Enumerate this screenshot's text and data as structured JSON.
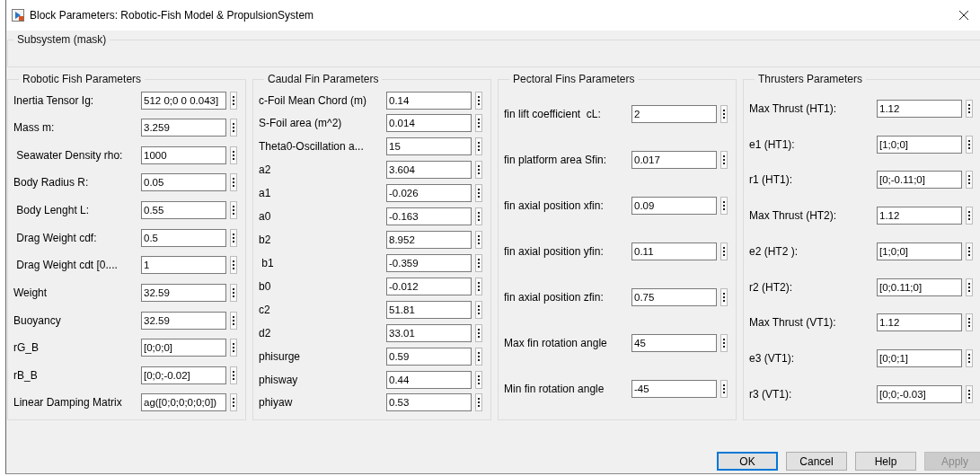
{
  "window": {
    "title": "Block Parameters: Robotic-Fish Model & PropulsionSystem"
  },
  "mask": {
    "title": "Subsystem (mask)"
  },
  "groups": [
    {
      "title": "Robotic Fish Parameters",
      "params": [
        {
          "label": "Inertia Tensor Ig:",
          "value": "512 0;0 0 0.043]"
        },
        {
          "label": "Mass m:",
          "value": "3.259"
        },
        {
          "label": " Seawater Density rho:",
          "value": "1000"
        },
        {
          "label": "Body Radius R:",
          "value": "0.05"
        },
        {
          "label": " Body Lenght L:",
          "value": "0.55"
        },
        {
          "label": " Drag Weight cdf:",
          "value": "0.5"
        },
        {
          "label": " Drag Weight cdt [0....",
          "value": "1"
        },
        {
          "label": "Weight",
          "value": "32.59"
        },
        {
          "label": "Buoyancy",
          "value": "32.59"
        },
        {
          "label": "rG_B",
          "value": "[0;0;0]"
        },
        {
          "label": "rB_B",
          "value": "[0;0;-0.02]"
        },
        {
          "label": "Linear Damping Matrix",
          "value": "ag([0;0;0;0;0;0])"
        }
      ]
    },
    {
      "title": "Caudal Fin Parameters",
      "params": [
        {
          "label": "c-Foil Mean Chord (m)",
          "value": "0.14"
        },
        {
          "label": "S-Foil area (m^2)",
          "value": "0.014"
        },
        {
          "label": "Theta0-Oscillation a...",
          "value": "15"
        },
        {
          "label": "a2",
          "value": "3.604"
        },
        {
          "label": "a1",
          "value": "-0.026"
        },
        {
          "label": "a0",
          "value": "-0.163"
        },
        {
          "label": "b2",
          "value": "8.952"
        },
        {
          "label": " b1",
          "value": "-0.359"
        },
        {
          "label": "b0",
          "value": "-0.012"
        },
        {
          "label": "c2",
          "value": "51.81"
        },
        {
          "label": "d2",
          "value": "33.01"
        },
        {
          "label": "phisurge",
          "value": "0.59"
        },
        {
          "label": "phisway",
          "value": "0.44"
        },
        {
          "label": "phiyaw",
          "value": "0.53"
        }
      ]
    },
    {
      "title": "Pectoral Fins Parameters",
      "params": [
        {
          "label": "fin lift coefficient  cL:",
          "value": "2"
        },
        {
          "label": "fin platform area Sfin:",
          "value": "0.017"
        },
        {
          "label": "fin axial position xfin:",
          "value": "0.09"
        },
        {
          "label": "fin axial position yfin:",
          "value": "0.11"
        },
        {
          "label": "fin axial position zfin:",
          "value": "0.75"
        },
        {
          "label": "Max fin rotation angle",
          "value": "45"
        },
        {
          "label": "Min fin rotation angle",
          "value": "-45"
        }
      ]
    },
    {
      "title": "Thrusters Parameters",
      "params": [
        {
          "label": "Max Thrust (HT1):",
          "value": "1.12"
        },
        {
          "label": "e1 (HT1):",
          "value": "[1;0;0]"
        },
        {
          "label": "r1 (HT1):",
          "value": "[0;-0.11;0]"
        },
        {
          "label": "Max Thrust (HT2):",
          "value": "1.12"
        },
        {
          "label": "e2 (HT2 ):",
          "value": "[1;0;0]"
        },
        {
          "label": "r2 (HT2):",
          "value": "[0;0.11;0]"
        },
        {
          "label": "Max Thrust (VT1):",
          "value": "1.12"
        },
        {
          "label": "e3 (VT1):",
          "value": "[0;0;1]"
        },
        {
          "label": "r3 (VT1):",
          "value": "[0;0;-0.03]"
        }
      ]
    }
  ],
  "buttons": [
    {
      "label": "OK",
      "focused": true,
      "disabled": false
    },
    {
      "label": "Cancel",
      "focused": false,
      "disabled": false
    },
    {
      "label": "Help",
      "focused": false,
      "disabled": false
    },
    {
      "label": "Apply",
      "focused": false,
      "disabled": true
    }
  ]
}
